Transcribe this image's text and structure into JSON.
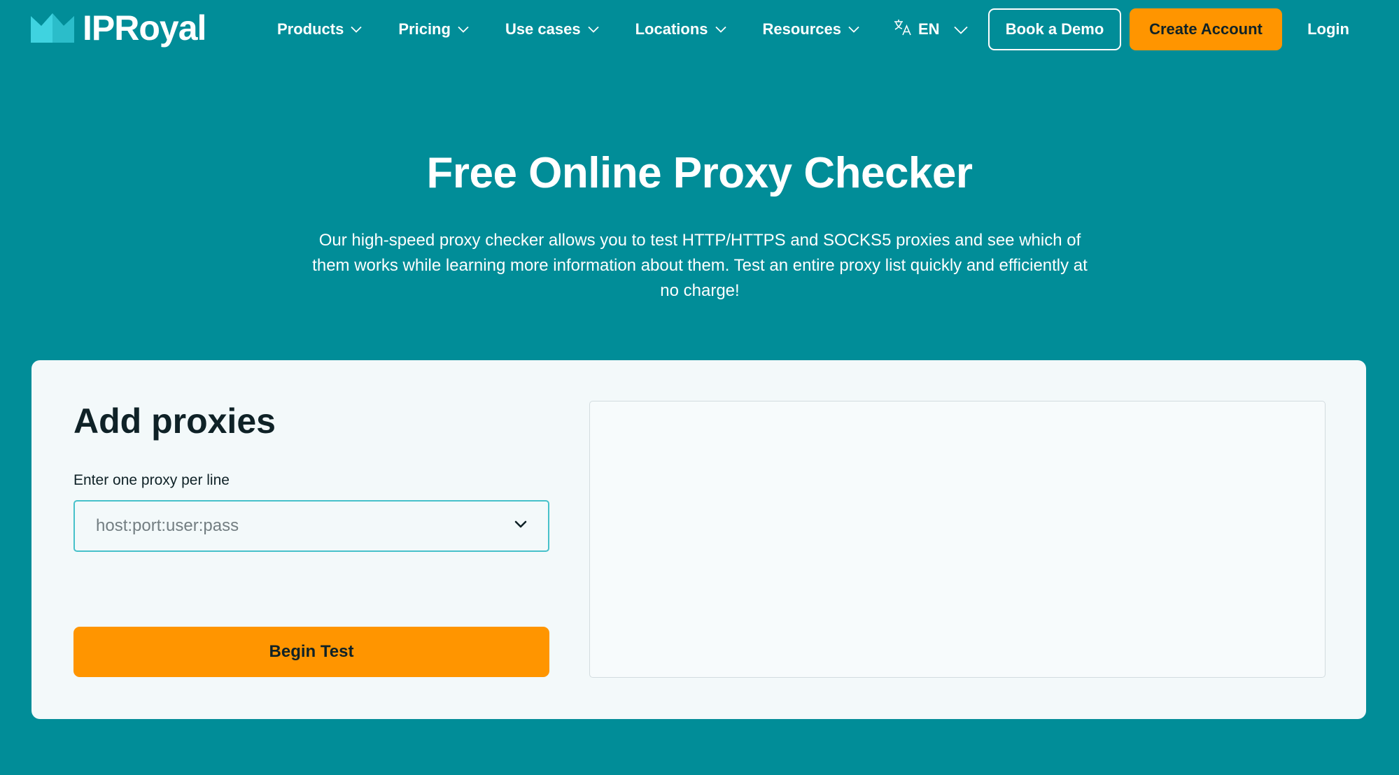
{
  "header": {
    "logo_text": "IPRoyal",
    "nav": [
      {
        "label": "Products"
      },
      {
        "label": "Pricing"
      },
      {
        "label": "Use cases"
      },
      {
        "label": "Locations"
      },
      {
        "label": "Resources"
      }
    ],
    "language": "EN",
    "book_demo_label": "Book a Demo",
    "create_account_label": "Create Account",
    "login_label": "Login"
  },
  "hero": {
    "title": "Free Online Proxy Checker",
    "description": "Our high-speed proxy checker allows you to test HTTP/HTTPS and SOCKS5 proxies and see which of them works while learning more information about them. Test an entire proxy list quickly and efficiently at no charge!"
  },
  "checker": {
    "title": "Add proxies",
    "field_label": "Enter one proxy per line",
    "input_placeholder": "host:port:user:pass",
    "begin_label": "Begin Test",
    "results_text": ""
  },
  "colors": {
    "background": "#018d98",
    "accent": "#ff9500",
    "card": "#f3f9fa",
    "logo_crown": "#3fd3e0",
    "input_border": "#47c1ca"
  },
  "icons": {
    "logo": "crown-icon",
    "nav_caret": "chevron-down-icon",
    "language": "translate-icon",
    "select_caret": "chevron-down-icon"
  }
}
